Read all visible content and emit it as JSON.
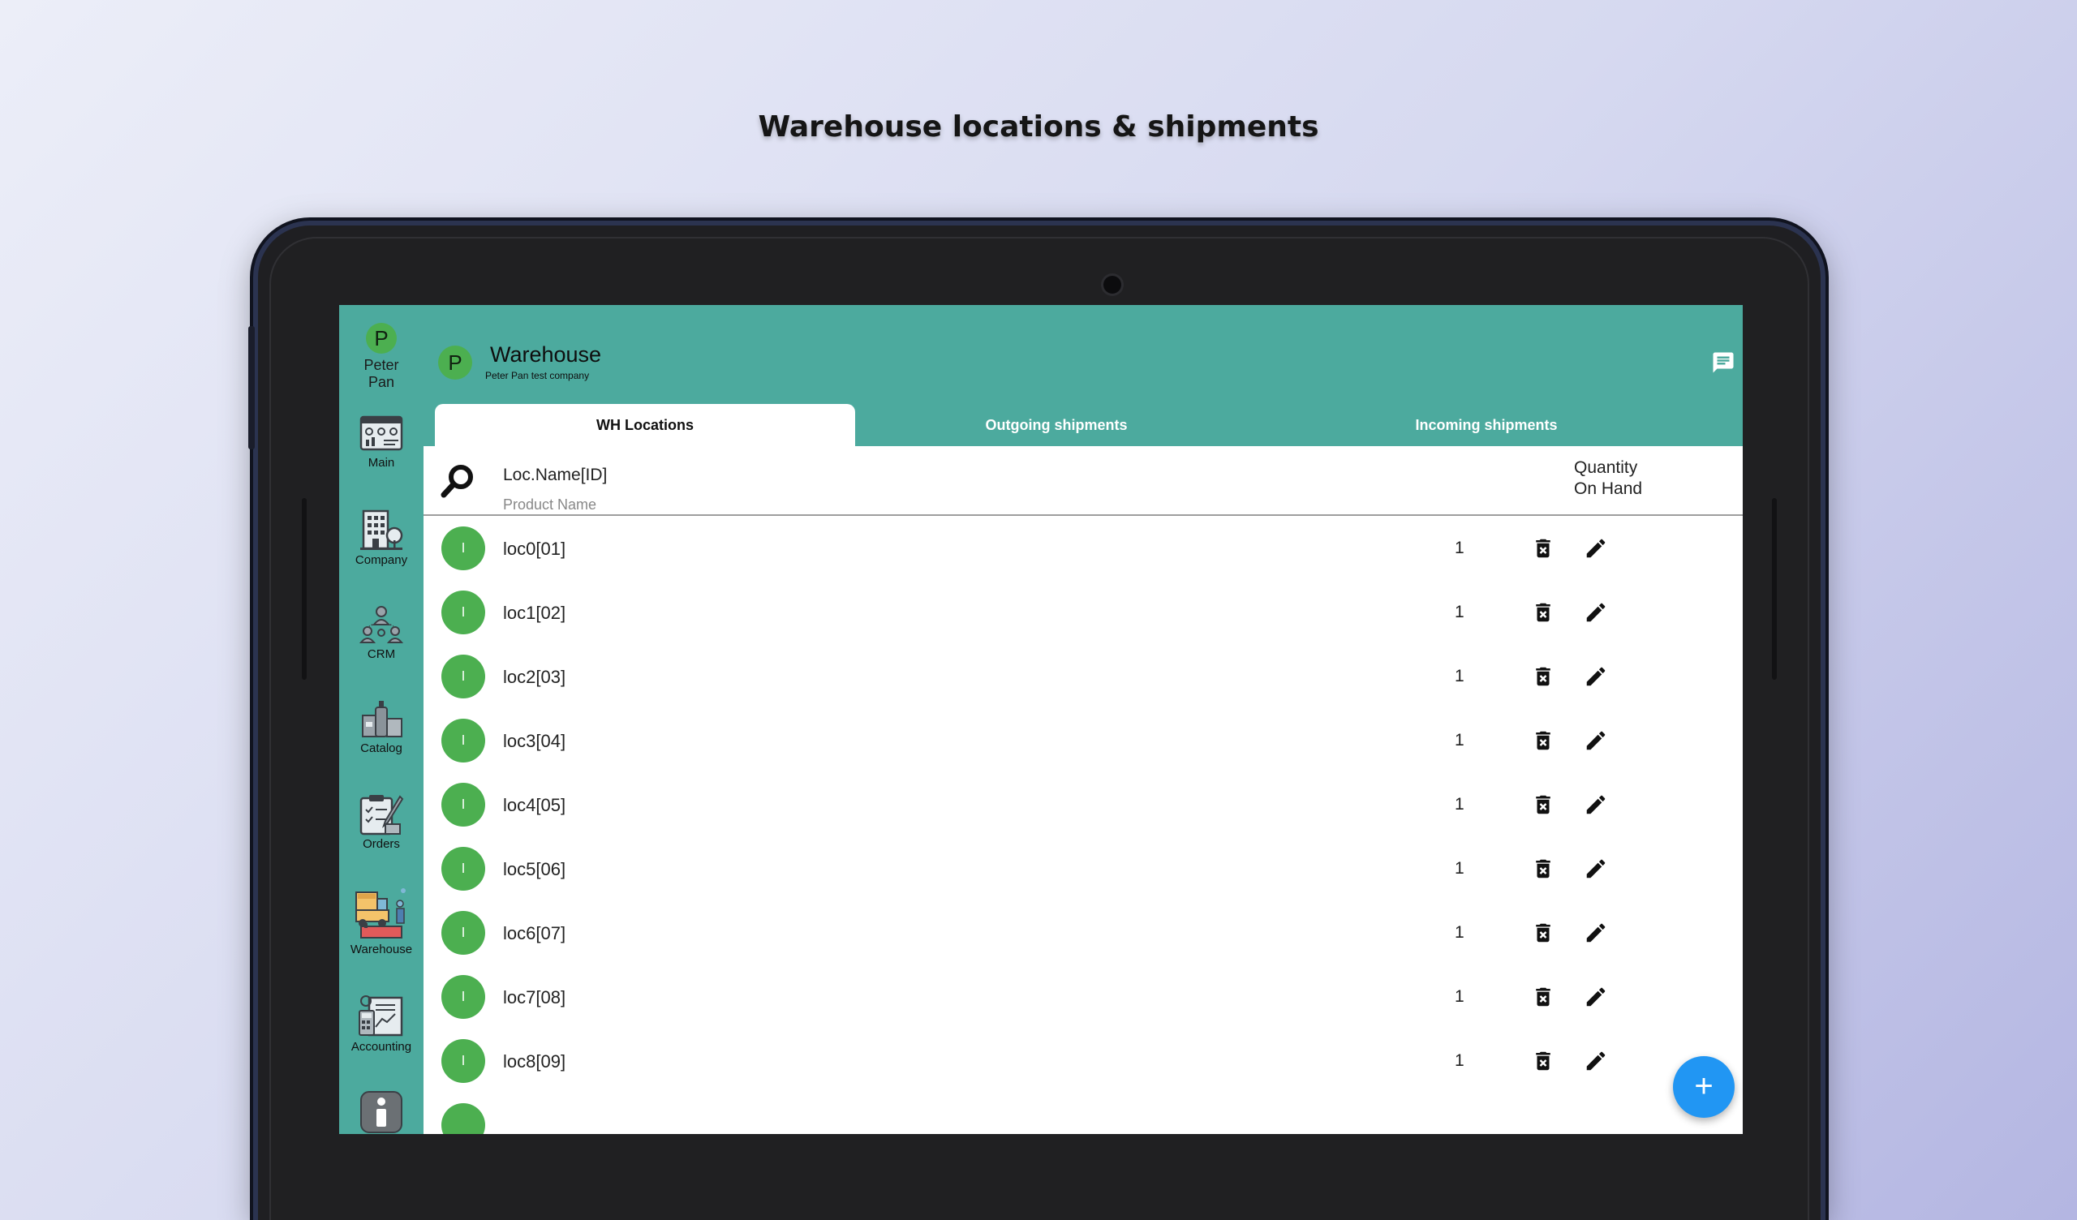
{
  "headline": "Warehouse locations & shipments",
  "user": {
    "initial": "P",
    "name": "Peter Pan"
  },
  "nav": [
    {
      "key": "main",
      "label": "Main",
      "icon": "dashboard-icon"
    },
    {
      "key": "company",
      "label": "Company",
      "icon": "building-icon"
    },
    {
      "key": "crm",
      "label": "CRM",
      "icon": "people-network-icon"
    },
    {
      "key": "catalog",
      "label": "Catalog",
      "icon": "products-icon"
    },
    {
      "key": "orders",
      "label": "Orders",
      "icon": "clipboard-icon"
    },
    {
      "key": "warehouse",
      "label": "Warehouse",
      "icon": "forklift-icon"
    },
    {
      "key": "accounting",
      "label": "Accounting",
      "icon": "calculator-icon"
    },
    {
      "key": "info",
      "label": "",
      "icon": "info-icon"
    }
  ],
  "header": {
    "avatar_initial": "P",
    "title": "Warehouse",
    "subtitle": "Peter Pan test company",
    "chat_icon": "chat-icon"
  },
  "tabs": [
    "WH Locations",
    "Outgoing shipments",
    "Incoming shipments"
  ],
  "active_tab": 0,
  "list_header": {
    "name_label": "Loc.Name[ID]",
    "product_label": "Product Name",
    "qty_line1": "Quantity",
    "qty_line2": "On Hand"
  },
  "rows": [
    {
      "initial": "l",
      "name": "loc0[01]",
      "qty": "1"
    },
    {
      "initial": "l",
      "name": "loc1[02]",
      "qty": "1"
    },
    {
      "initial": "l",
      "name": "loc2[03]",
      "qty": "1"
    },
    {
      "initial": "l",
      "name": "loc3[04]",
      "qty": "1"
    },
    {
      "initial": "l",
      "name": "loc4[05]",
      "qty": "1"
    },
    {
      "initial": "l",
      "name": "loc5[06]",
      "qty": "1"
    },
    {
      "initial": "l",
      "name": "loc6[07]",
      "qty": "1"
    },
    {
      "initial": "l",
      "name": "loc7[08]",
      "qty": "1"
    },
    {
      "initial": "l",
      "name": "loc8[09]",
      "qty": "1"
    }
  ],
  "fab": "+",
  "colors": {
    "teal": "#4caa9e",
    "avatar_green": "#4caf50",
    "fab_blue": "#2196f3"
  }
}
